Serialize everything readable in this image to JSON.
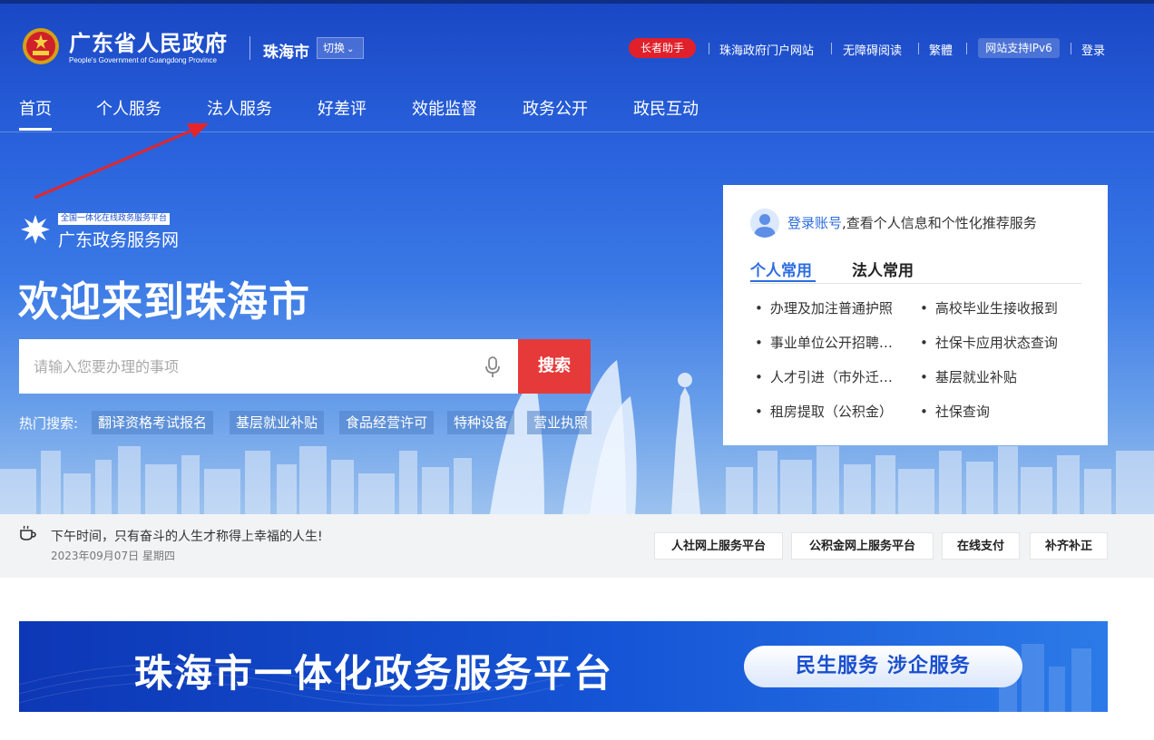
{
  "header": {
    "gov_title": "广东省人民政府",
    "gov_subtitle": "People's Government of Guangdong Province",
    "city": "珠海市",
    "switch_label": "切换",
    "elder_helper": "长者助手",
    "links": [
      "珠海政府门户网站",
      "无障碍阅读",
      "繁體"
    ],
    "ipv6": "网站支持IPv6",
    "login": "登录"
  },
  "nav": {
    "items": [
      "首页",
      "个人服务",
      "法人服务",
      "好差评",
      "效能监督",
      "政务公开",
      "政民互动"
    ],
    "active_index": 0
  },
  "brand": {
    "tag": "全国一体化在线政务服务平台",
    "name": "广东政务服务网"
  },
  "welcome": "欢迎来到珠海市",
  "search": {
    "placeholder": "请输入您要办理的事项",
    "button": "搜索",
    "hot_label": "热门搜索:",
    "hot_tags": [
      "翻译资格考试报名",
      "基层就业补贴",
      "食品经营许可",
      "特种设备",
      "营业执照"
    ]
  },
  "card": {
    "login_link": "登录账号",
    "login_text": ",查看个人信息和个性化推荐服务",
    "tabs": [
      "个人常用",
      "法人常用"
    ],
    "active_tab": 0,
    "items": [
      "办理及加注普通护照",
      "高校毕业生接收报到",
      "事业单位公开招聘…",
      "社保卡应用状态查询",
      "人才引进（市外迁…",
      "基层就业补贴",
      "租房提取（公积金）",
      "社保查询"
    ]
  },
  "info": {
    "motto": "下午时间，只有奋斗的人生才称得上幸福的人生!",
    "date": "2023年09月07日 星期四",
    "quick_buttons": [
      "人社网上服务平台",
      "公积金网上服务平台",
      "在线支付",
      "补齐补正"
    ]
  },
  "banner": {
    "title": "珠海市一体化政务服务平台",
    "pill": "民生服务 涉企服务"
  },
  "colors": {
    "primary_blue": "#2c6ce0",
    "search_red": "#e63a3a",
    "elder_red": "#e0202a"
  }
}
